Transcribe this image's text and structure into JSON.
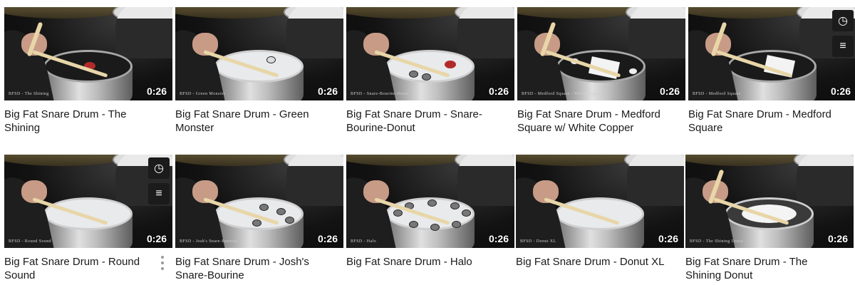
{
  "videos": [
    {
      "title": "Big Fat Snare Drum - The Shining",
      "duration": "0:26",
      "overlay": "BFSD - The Shining",
      "head": "dark"
    },
    {
      "title": "Big Fat Snare Drum - Green Monster",
      "duration": "0:26",
      "overlay": "BFSD - Green Monster",
      "head": "white"
    },
    {
      "title": "Big Fat Snare Drum - Snare-Bourine-Donut",
      "duration": "0:26",
      "overlay": "BFSD - Snare-Bourine-Donut",
      "head": "white"
    },
    {
      "title": "Big Fat Snare Drum - Medford Square w/ White Copper",
      "duration": "0:26",
      "overlay": "BFSD - Medford Square - White Copper",
      "head": "dark"
    },
    {
      "title": "Big Fat Snare Drum - Medford Square",
      "duration": "0:26",
      "overlay": "BFSD - Medford Square",
      "head": "dark"
    },
    {
      "title": "Big Fat Snare Drum - Round Sound",
      "duration": "0:26",
      "overlay": "BFSD - Round Sound",
      "head": "white"
    },
    {
      "title": "Big Fat Snare Drum - Josh's Snare-Bourine",
      "duration": "0:26",
      "overlay": "BFSD - Josh's Snare-Bourine",
      "head": "white"
    },
    {
      "title": "Big Fat Snare Drum - Halo",
      "duration": "0:26",
      "overlay": "BFSD - Halo",
      "head": "white"
    },
    {
      "title": "Big Fat Snare Drum - Donut XL",
      "duration": "0:26",
      "overlay": "BFSD - Donut XL",
      "head": "white"
    },
    {
      "title": "Big Fat Snare Drum - The Shining Donut",
      "duration": "0:26",
      "overlay": "BFSD - The Shining Donut",
      "head": "clear"
    }
  ],
  "icons": {
    "watch_later": "clock-icon",
    "add_to_queue": "queue-icon",
    "more": "more-vertical-icon"
  }
}
